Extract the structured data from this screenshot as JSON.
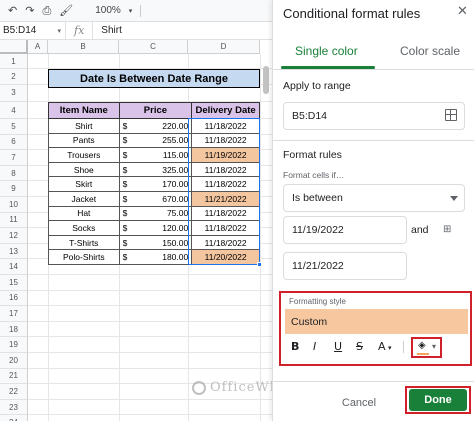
{
  "toolbar": {
    "zoom": "100%",
    "icons": [
      "undo-icon",
      "redo-icon",
      "print-icon",
      "paint-format-icon"
    ]
  },
  "formula_bar": {
    "cell_ref": "B5:D14",
    "fx": "fx",
    "value": "Shirt"
  },
  "sheet": {
    "columns": [
      "A",
      "B",
      "C",
      "D"
    ],
    "rows": [
      "1",
      "2",
      "3",
      "4",
      "5",
      "6",
      "7",
      "8",
      "9",
      "10",
      "11",
      "12",
      "13",
      "14",
      "15",
      "16",
      "17",
      "18",
      "19",
      "20",
      "21",
      "22",
      "23",
      "24"
    ],
    "title": "Date Is Between Date Range",
    "headers": [
      "Item Name",
      "Price",
      "Delivery Date"
    ],
    "currency_symbol": "$",
    "data": [
      {
        "item": "Shirt",
        "price": "220.00",
        "date": "11/18/2022",
        "highlight": false
      },
      {
        "item": "Pants",
        "price": "255.00",
        "date": "11/18/2022",
        "highlight": false
      },
      {
        "item": "Trousers",
        "price": "115.00",
        "date": "11/19/2022",
        "highlight": true
      },
      {
        "item": "Shoe",
        "price": "325.00",
        "date": "11/18/2022",
        "highlight": false
      },
      {
        "item": "Skirt",
        "price": "170.00",
        "date": "11/18/2022",
        "highlight": false
      },
      {
        "item": "Jacket",
        "price": "670.00",
        "date": "11/21/2022",
        "highlight": true
      },
      {
        "item": "Hat",
        "price": "75.00",
        "date": "11/18/2022",
        "highlight": false
      },
      {
        "item": "Socks",
        "price": "120.00",
        "date": "11/18/2022",
        "highlight": false
      },
      {
        "item": "T-Shirts",
        "price": "150.00",
        "date": "11/18/2022",
        "highlight": false
      },
      {
        "item": "Polo-Shirts",
        "price": "180.00",
        "date": "11/20/2022",
        "highlight": true
      }
    ],
    "highlight_color": "#f4c6a0",
    "title_color": "#c5d9f1",
    "header_color": "#d9c3e9",
    "watermark": "OfficeWheel"
  },
  "panel": {
    "title": "Conditional format rules",
    "tabs": [
      "Single color",
      "Color scale"
    ],
    "apply_label": "Apply to range",
    "range_value": "B5:D14",
    "format_rules_label": "Format rules",
    "format_cells_if": "Format cells if…",
    "condition": "Is between",
    "value1": "11/19/2022",
    "and_label": "and",
    "value2": "11/21/2022",
    "formatting_style_label": "Formatting style",
    "style_preset": "Custom",
    "style_preview_color": "#f7c8a0",
    "format_buttons": [
      "B",
      "I",
      "U",
      "S",
      "A"
    ],
    "cancel_label": "Cancel",
    "done_label": "Done",
    "accent_color": "#188038"
  }
}
